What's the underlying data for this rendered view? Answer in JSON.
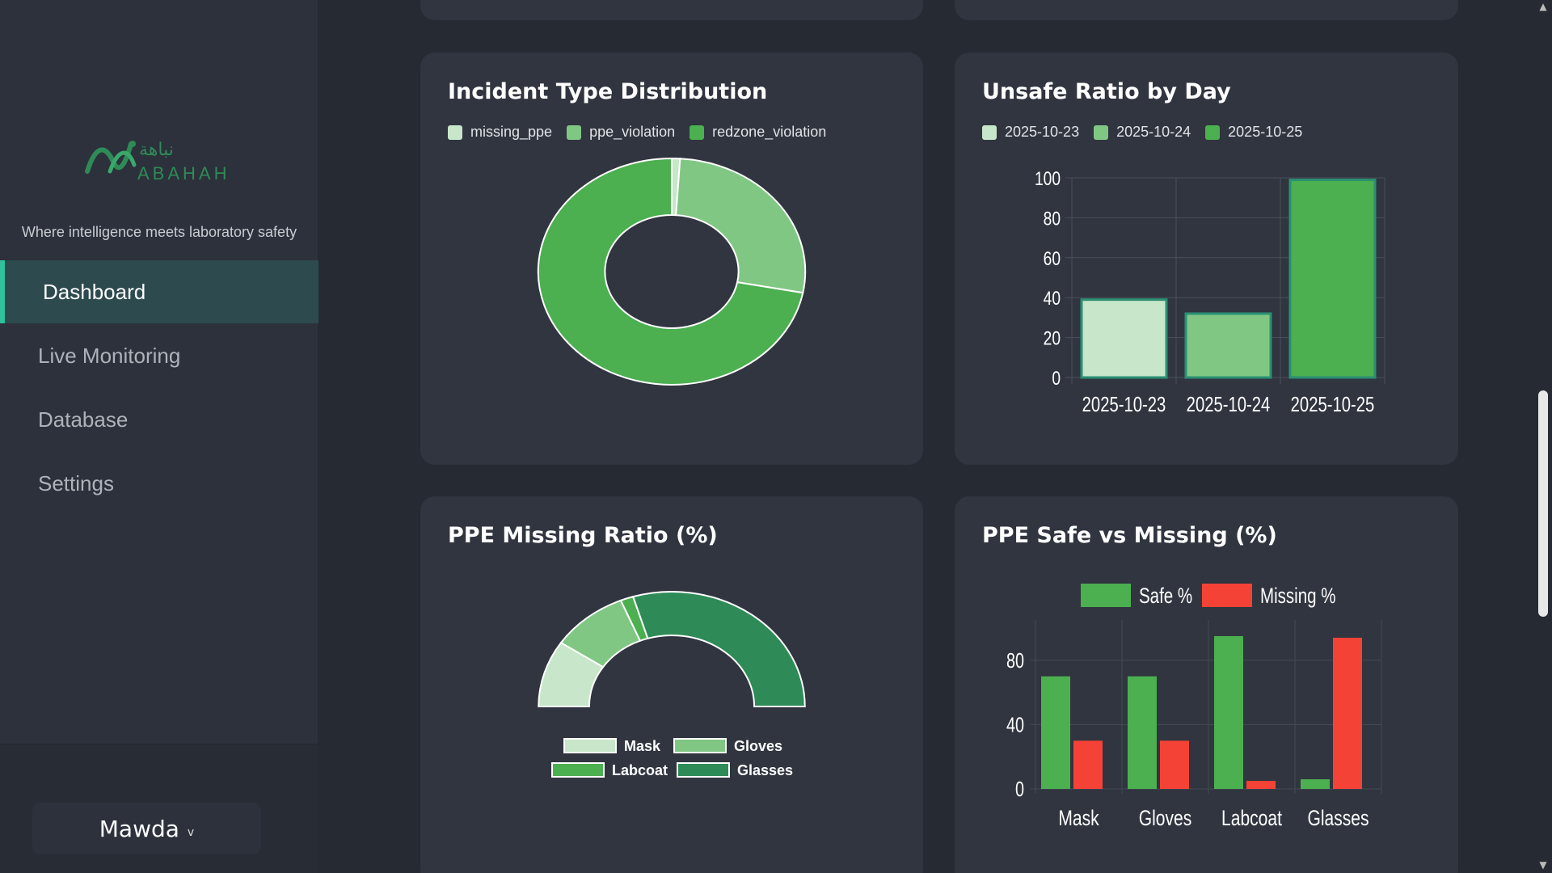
{
  "sidebar": {
    "logo_text": "NABAHAH",
    "tagline": "Where intelligence meets laboratory safety",
    "nav": [
      {
        "label": "Dashboard",
        "active": true
      },
      {
        "label": "Live Monitoring",
        "active": false
      },
      {
        "label": "Database",
        "active": false
      },
      {
        "label": "Settings",
        "active": false
      }
    ],
    "user": {
      "name": "Mawda",
      "chevron": "v"
    }
  },
  "colors": {
    "green_light": "#c8e6c9",
    "green_mid": "#81c784",
    "green": "#4caf50",
    "green_dark": "#2e8b57",
    "red": "#f44336",
    "accent": "#2fc19b"
  },
  "cards": {
    "incident": {
      "title": "Incident Type Distribution"
    },
    "unsafe": {
      "title": "Unsafe Ratio by Day"
    },
    "ppe_missing": {
      "title": "PPE Missing Ratio (%)"
    },
    "ppe_safe": {
      "title": "PPE Safe vs Missing (%)"
    }
  },
  "chart_data": [
    {
      "id": "incident",
      "type": "pie",
      "title": "Incident Type Distribution",
      "labels": [
        "missing_ppe",
        "ppe_violation",
        "redzone_violation"
      ],
      "values": [
        1,
        27,
        72
      ],
      "colors": [
        "#c8e6c9",
        "#81c784",
        "#4caf50"
      ],
      "legend": "top-left"
    },
    {
      "id": "unsafe",
      "type": "bar",
      "title": "Unsafe Ratio by Day",
      "categories": [
        "2025-10-23",
        "2025-10-24",
        "2025-10-25"
      ],
      "values": [
        39,
        32,
        99
      ],
      "colors": [
        "#c8e6c9",
        "#81c784",
        "#4caf50"
      ],
      "yticks": [
        0,
        20,
        40,
        60,
        80,
        100
      ],
      "ylim": [
        0,
        100
      ],
      "grid": true,
      "legend": "top-left"
    },
    {
      "id": "ppe_missing",
      "type": "pie",
      "title": "PPE Missing Ratio (%)",
      "labels": [
        "Mask",
        "Gloves",
        "Labcoat",
        "Glasses"
      ],
      "values": [
        30,
        30,
        5,
        95
      ],
      "colors": [
        "#c8e6c9",
        "#81c784",
        "#4caf50",
        "#2e8b57"
      ],
      "legend": "bottom"
    },
    {
      "id": "ppe_safe",
      "type": "bar",
      "title": "PPE Safe vs Missing (%)",
      "categories": [
        "Mask",
        "Gloves",
        "Labcoat",
        "Glasses"
      ],
      "series": [
        {
          "name": "Safe %",
          "values": [
            70,
            70,
            95,
            6
          ],
          "color": "#4caf50"
        },
        {
          "name": "Missing %",
          "values": [
            30,
            30,
            5,
            94
          ],
          "color": "#f44336"
        }
      ],
      "yticks": [
        0,
        40,
        80
      ],
      "ylim": [
        0,
        100
      ],
      "grid": true,
      "legend": "top"
    }
  ]
}
